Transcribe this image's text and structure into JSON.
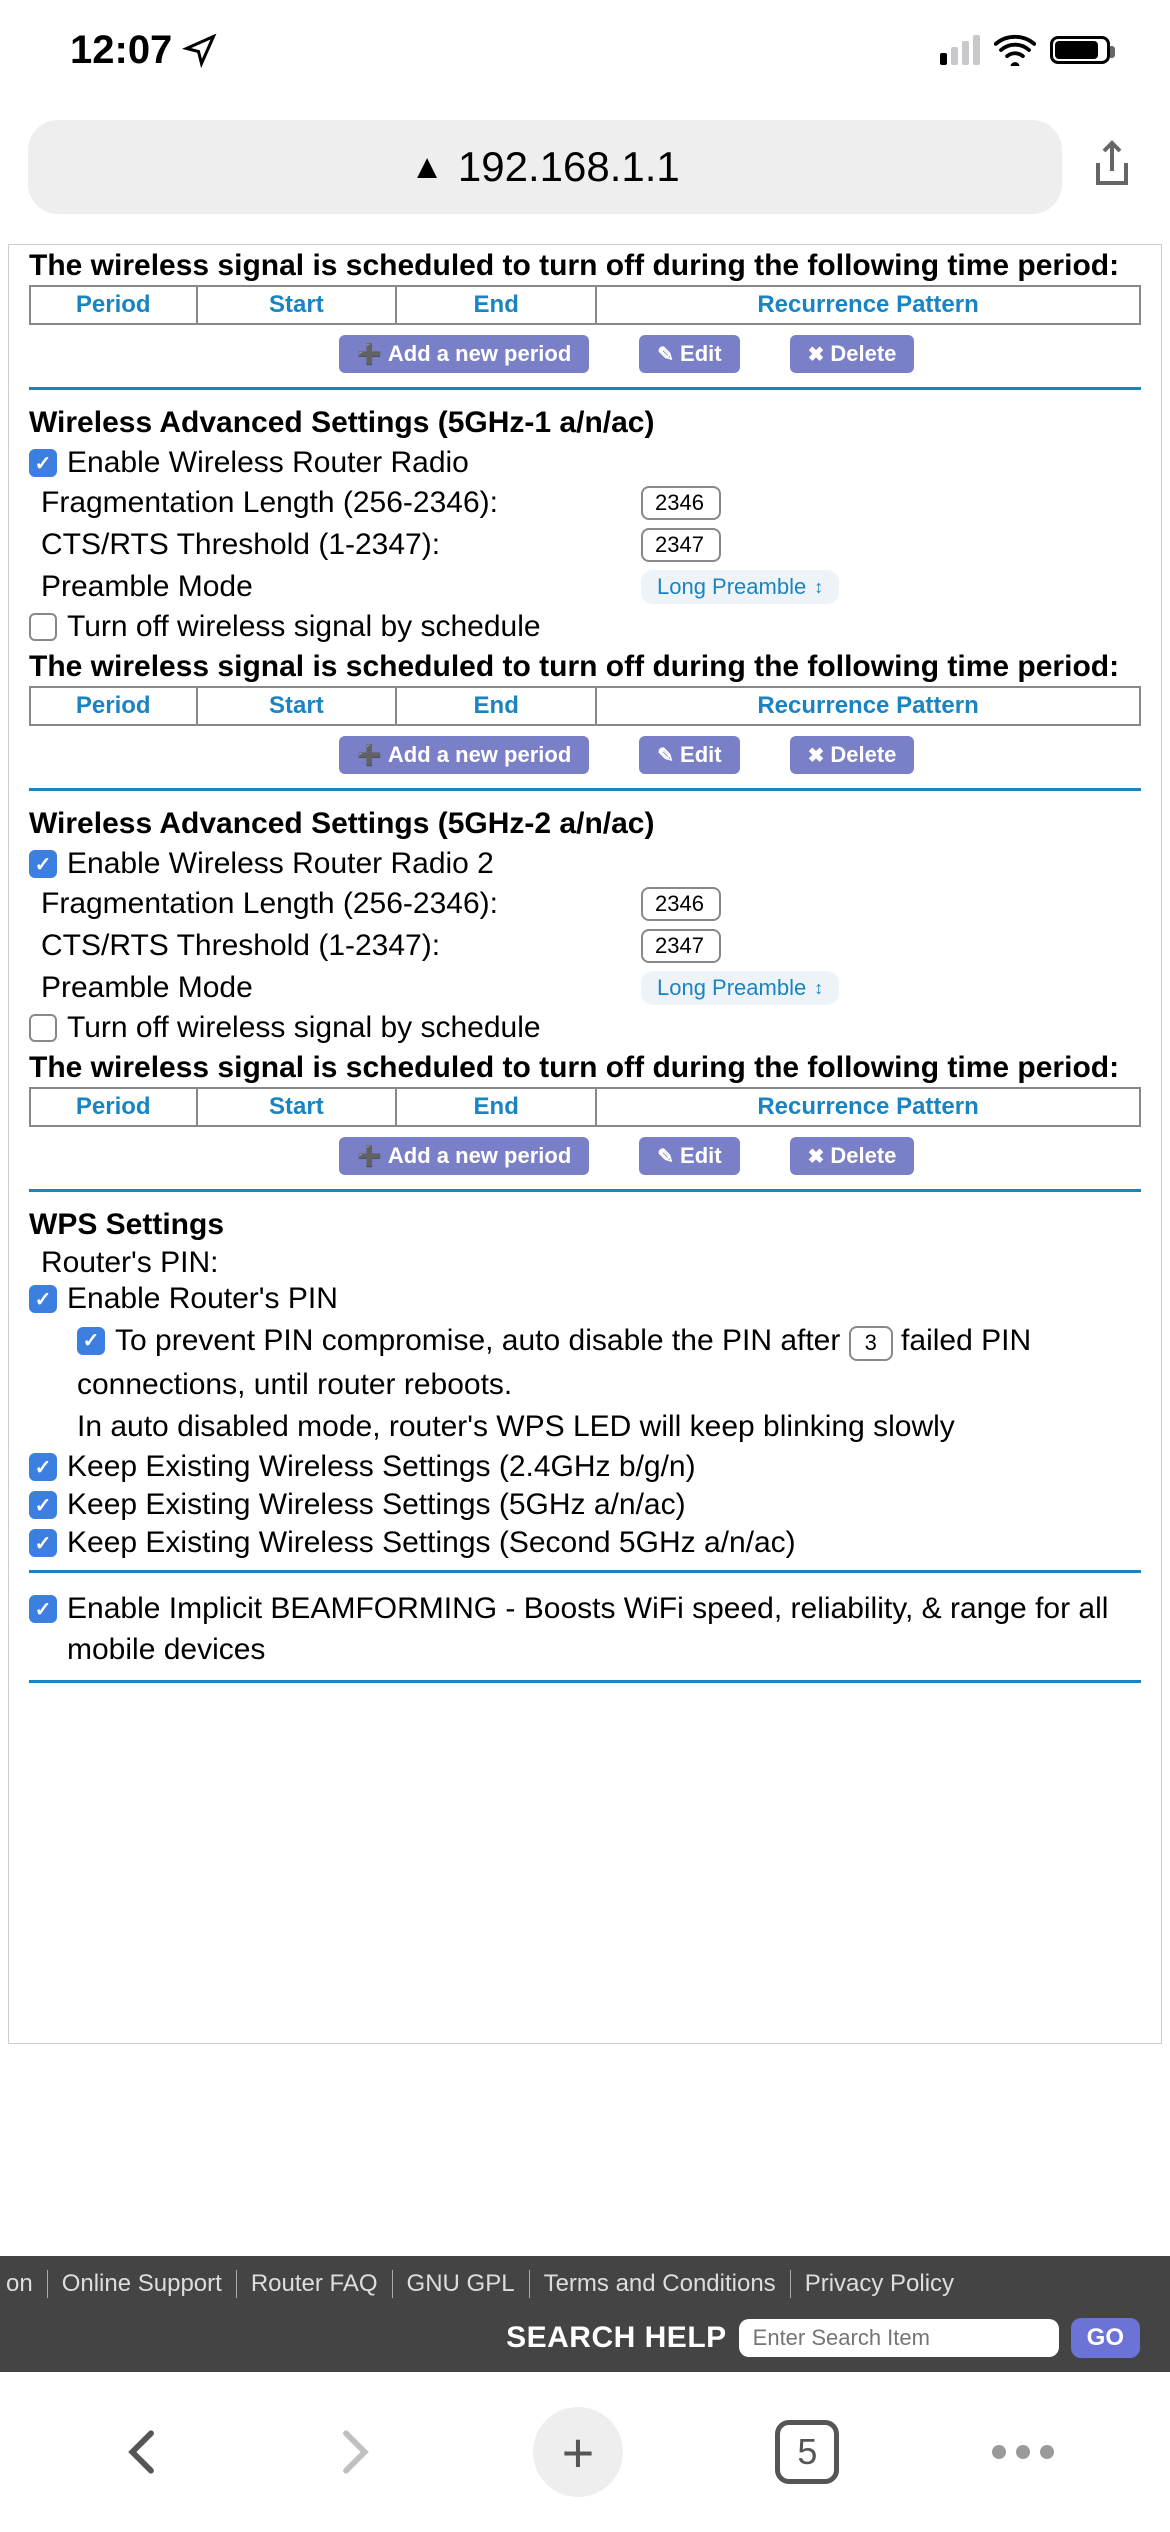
{
  "status": {
    "time": "12:07"
  },
  "url_bar": {
    "address": "192.168.1.1"
  },
  "sections": {
    "s1": {
      "sched_heading": "The wireless signal is scheduled to turn off during the following time period:",
      "cols": [
        "Period",
        "Start",
        "End",
        "Recurrence Pattern"
      ],
      "add": "Add a new period",
      "edit": "Edit",
      "delete": "Delete"
    },
    "s2": {
      "title": "Wireless Advanced Settings (5GHz-1 a/n/ac)",
      "enable_label": "Enable Wireless Router Radio",
      "frag_label": "Fragmentation Length (256-2346):",
      "frag_val": "2346",
      "cts_label": "CTS/RTS Threshold (1-2347):",
      "cts_val": "2347",
      "preamble_label": "Preamble Mode",
      "preamble_val": "Long Preamble",
      "turnoff_label": "Turn off wireless signal by schedule",
      "sched_heading": "The wireless signal is scheduled to turn off during the following time period:",
      "cols": [
        "Period",
        "Start",
        "End",
        "Recurrence Pattern"
      ],
      "add": "Add a new period",
      "edit": "Edit",
      "delete": "Delete"
    },
    "s3": {
      "title": "Wireless Advanced Settings (5GHz-2 a/n/ac)",
      "enable_label": "Enable Wireless Router Radio 2",
      "frag_label": "Fragmentation Length (256-2346):",
      "frag_val": "2346",
      "cts_label": "CTS/RTS Threshold (1-2347):",
      "cts_val": "2347",
      "preamble_label": "Preamble Mode",
      "preamble_val": "Long Preamble",
      "turnoff_label": "Turn off wireless signal by schedule",
      "sched_heading": "The wireless signal is scheduled to turn off during the following time period:",
      "cols": [
        "Period",
        "Start",
        "End",
        "Recurrence Pattern"
      ],
      "add": "Add a new period",
      "edit": "Edit",
      "delete": "Delete"
    },
    "wps": {
      "title": "WPS Settings",
      "pin_label": "Router's PIN:",
      "enable_pin": "Enable Router's PIN",
      "auto_disable_pre": "To prevent PIN compromise, auto disable the PIN after",
      "auto_disable_val": "3",
      "auto_disable_post": "failed PIN",
      "auto_disable_line2": "connections, until router reboots.",
      "auto_disable_line3": "In auto disabled mode, router's WPS LED will keep blinking slowly",
      "keep24": "Keep Existing Wireless Settings (2.4GHz b/g/n)",
      "keep5": "Keep Existing Wireless Settings (5GHz a/n/ac)",
      "keep5b": "Keep Existing Wireless Settings (Second 5GHz a/n/ac)"
    },
    "beam": {
      "label": "Enable Implicit BEAMFORMING - Boosts WiFi speed, reliability, & range for all mobile devices"
    }
  },
  "footer": {
    "links": [
      "on",
      "Online Support",
      "Router FAQ",
      "GNU GPL",
      "Terms and Conditions",
      "Privacy Policy"
    ],
    "search_label": "SEARCH HELP",
    "search_placeholder": "Enter Search Item",
    "go": "GO"
  },
  "bottom_nav": {
    "tabs": "5"
  }
}
